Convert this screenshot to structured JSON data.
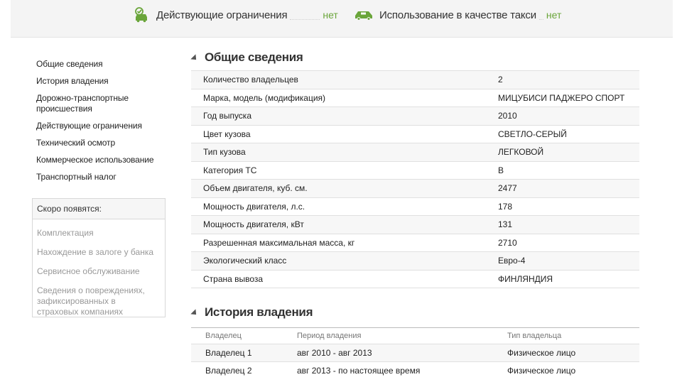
{
  "banner": {
    "restrictions": {
      "label": "Действующие ограничения",
      "value": "нет",
      "icon": "car-check-icon"
    },
    "taxi": {
      "label": "Использование в качестве такси",
      "value": "нет",
      "icon": "taxi-icon"
    },
    "accent_color": "#6aa53a"
  },
  "sidebar": {
    "links": [
      "Общие сведения",
      "История владения",
      "Дорожно-транспортные происшествия",
      "Действующие ограничения",
      "Технический осмотр",
      "Коммерческое использование",
      "Транспортный налог"
    ],
    "soon": {
      "title": "Скоро появятся:",
      "items": [
        "Комплектация",
        "Нахождение в залоге у банка",
        "Сервисное обслуживание",
        "Сведения о повреждениях, зафиксированных в страховых компаниях"
      ]
    }
  },
  "general": {
    "title": "Общие сведения",
    "rows": [
      {
        "key": "Количество владельцев",
        "value": "2"
      },
      {
        "key": "Марка, модель (модификация)",
        "value": "МИЦУБИСИ ПАДЖЕРО СПОРТ"
      },
      {
        "key": "Год выпуска",
        "value": "2010"
      },
      {
        "key": "Цвет кузова",
        "value": "СВЕТЛО-СЕРЫЙ"
      },
      {
        "key": "Тип кузова",
        "value": "ЛЕГКОВОЙ"
      },
      {
        "key": "Категория ТС",
        "value": "B"
      },
      {
        "key": "Объем двигателя, куб. см.",
        "value": "2477"
      },
      {
        "key": "Мощность двигателя, л.с.",
        "value": "178"
      },
      {
        "key": "Мощность двигателя, кВт",
        "value": "131"
      },
      {
        "key": "Разрешенная максимальная масса, кг",
        "value": "2710"
      },
      {
        "key": "Экологический класс",
        "value": "Евро-4"
      },
      {
        "key": "Страна вывоза",
        "value": "ФИНЛЯНДИЯ"
      }
    ]
  },
  "history": {
    "title": "История владения",
    "columns": [
      "Владелец",
      "Период владения",
      "Тип владельца"
    ],
    "rows": [
      {
        "owner": "Владелец 1",
        "period": "авг 2010 - авг 2013",
        "type": "Физическое лицо"
      },
      {
        "owner": "Владелец 2",
        "period": "авг 2013 - по настоящее время",
        "type": "Физическое лицо"
      }
    ]
  }
}
